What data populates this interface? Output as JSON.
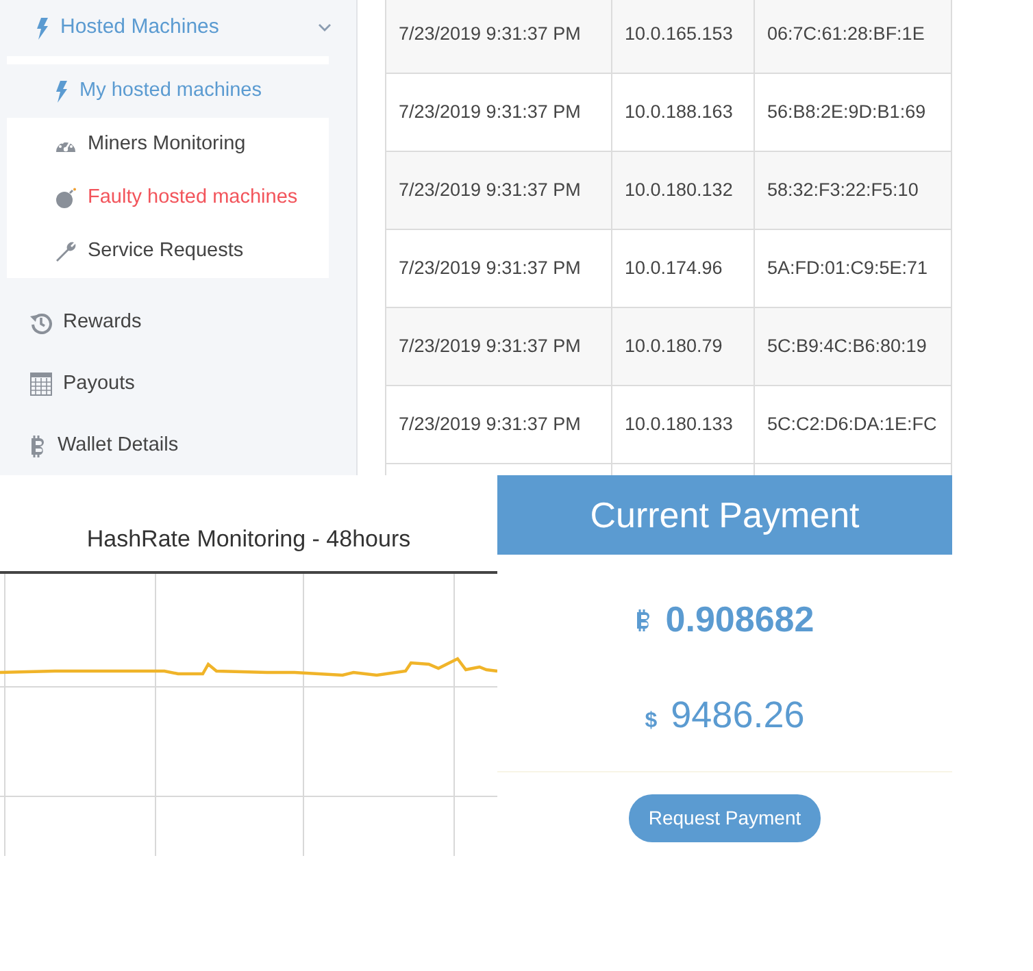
{
  "sidebar": {
    "group": {
      "label": "Hosted Machines",
      "expanded": true,
      "children": [
        {
          "label": "My hosted machines",
          "selected": true,
          "color": "#5b9bd1"
        },
        {
          "label": "Miners Monitoring",
          "selected": false,
          "color": "#444444"
        },
        {
          "label": "Faulty hosted machines",
          "selected": false,
          "color": "#f2545b"
        },
        {
          "label": "Service Requests",
          "selected": false,
          "color": "#444444"
        }
      ]
    },
    "items": [
      {
        "label": "Rewards"
      },
      {
        "label": "Payouts"
      },
      {
        "label": "Wallet Details"
      }
    ]
  },
  "table": {
    "rows": [
      [
        "7/23/2019 9:31:37 PM",
        "10.0.165.153",
        "06:7C:61:28:BF:1E"
      ],
      [
        "7/23/2019 9:31:37 PM",
        "10.0.188.163",
        "56:B8:2E:9D:B1:69"
      ],
      [
        "7/23/2019 9:31:37 PM",
        "10.0.180.132",
        "58:32:F3:22:F5:10"
      ],
      [
        "7/23/2019 9:31:37 PM",
        "10.0.174.96",
        "5A:FD:01:C9:5E:71"
      ],
      [
        "7/23/2019 9:31:37 PM",
        "10.0.180.79",
        "5C:B9:4C:B6:80:19"
      ],
      [
        "7/23/2019 9:31:37 PM",
        "10.0.180.133",
        "5C:C2:D6:DA:1E:FC"
      ]
    ]
  },
  "chart": {
    "title": "HashRate Monitoring - 48hours"
  },
  "payment": {
    "title": "Current Payment",
    "btc_amount": "0.908682",
    "usd_symbol": "$",
    "usd_amount": "9486.26",
    "button": "Request Payment"
  }
}
